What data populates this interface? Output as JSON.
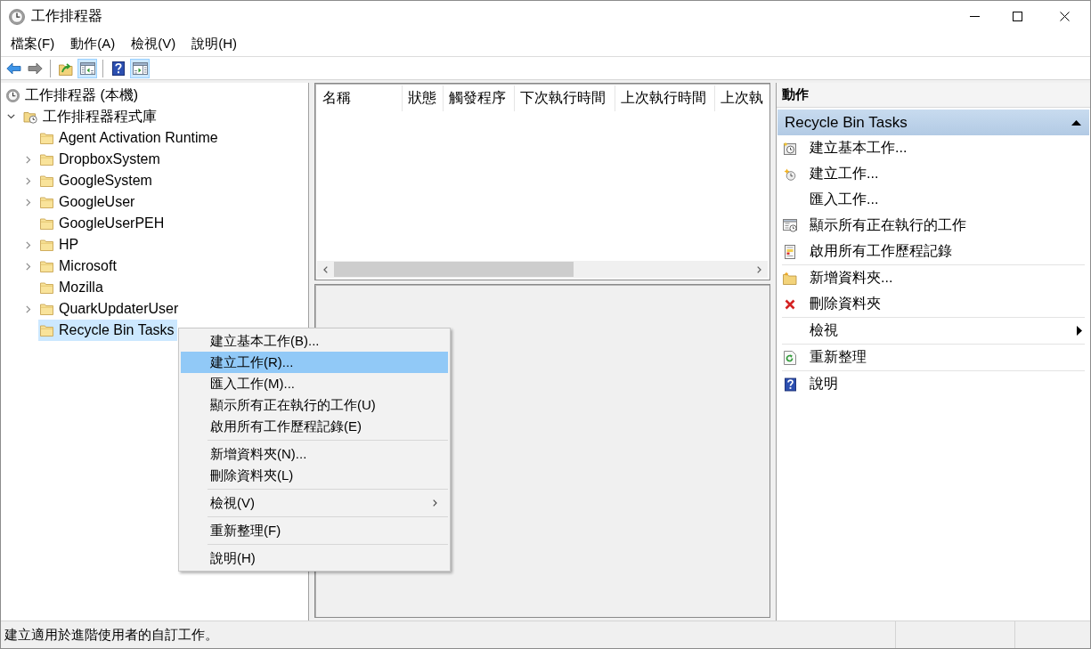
{
  "window": {
    "title": "工作排程器"
  },
  "menu_bar": {
    "items": [
      "檔案(F)",
      "動作(A)",
      "檢視(V)",
      "說明(H)"
    ]
  },
  "toolbar": {
    "items": [
      {
        "kind": "back",
        "disabled": false,
        "on": false
      },
      {
        "kind": "forward",
        "disabled": true,
        "on": false
      },
      {
        "kind": "separator"
      },
      {
        "kind": "up-folder",
        "disabled": false,
        "on": false
      },
      {
        "kind": "console-tree",
        "disabled": false,
        "on": true
      },
      {
        "kind": "separator"
      },
      {
        "kind": "help",
        "disabled": false,
        "on": false
      },
      {
        "kind": "action-pane",
        "disabled": false,
        "on": true
      }
    ]
  },
  "console_tree": {
    "items": [
      {
        "kind": "scheduler",
        "label": "工作排程器 (本機)",
        "selected": false,
        "children": [
          {
            "kind": "library",
            "label": "工作排程器程式庫",
            "expanded": true,
            "selected": false,
            "children": [
              {
                "kind": "folder",
                "label": "Agent Activation Runtime",
                "selected": false
              },
              {
                "kind": "folder",
                "label": "DropboxSystem",
                "expanded": false,
                "selected": false
              },
              {
                "kind": "folder",
                "label": "GoogleSystem",
                "expanded": false,
                "selected": false
              },
              {
                "kind": "folder",
                "label": "GoogleUser",
                "expanded": false,
                "selected": false
              },
              {
                "kind": "folder",
                "label": "GoogleUserPEH",
                "selected": false
              },
              {
                "kind": "folder",
                "label": "HP",
                "expanded": false,
                "selected": false
              },
              {
                "kind": "folder",
                "label": "Microsoft",
                "expanded": false,
                "selected": false
              },
              {
                "kind": "folder",
                "label": "Mozilla",
                "selected": false
              },
              {
                "kind": "folder",
                "label": "QuarkUpdaterUser",
                "expanded": false,
                "selected": false
              },
              {
                "kind": "folder",
                "label": "Recycle Bin Tasks",
                "selected": true
              }
            ]
          }
        ]
      }
    ]
  },
  "task_list": {
    "columns": [
      "名稱",
      "狀態",
      "觸發程序",
      "下次執行時間",
      "上次執行時間",
      "上次執"
    ]
  },
  "actions_pane": {
    "title": "動作",
    "sections": [
      {
        "title": "Recycle Bin Tasks",
        "expanded": true,
        "groups": [
          {
            "items": [
              {
                "kind": "basic-task",
                "label": "建立基本工作...",
                "submenu": false
              },
              {
                "kind": "task",
                "label": "建立工作...",
                "submenu": false
              },
              {
                "kind": "import",
                "label": "匯入工作...",
                "submenu": false
              },
              {
                "kind": "running",
                "label": "顯示所有正在執行的工作",
                "submenu": false
              },
              {
                "kind": "history",
                "label": "啟用所有工作歷程記錄",
                "submenu": false
              }
            ]
          },
          {
            "items": [
              {
                "kind": "new-folder",
                "label": "新增資料夾...",
                "submenu": false
              },
              {
                "kind": "delete",
                "label": "刪除資料夾",
                "submenu": false
              }
            ]
          },
          {
            "items": [
              {
                "kind": "view",
                "label": "檢視",
                "submenu": true
              }
            ]
          },
          {
            "items": [
              {
                "kind": "refresh",
                "label": "重新整理",
                "submenu": false
              }
            ]
          },
          {
            "items": [
              {
                "kind": "help",
                "label": "說明",
                "submenu": false
              }
            ]
          }
        ]
      }
    ]
  },
  "context_menu": {
    "groups": [
      {
        "items": [
          {
            "label": "建立基本工作(B)...",
            "selected": false,
            "submenu": false
          },
          {
            "label": "建立工作(R)...",
            "selected": true,
            "submenu": false
          },
          {
            "label": "匯入工作(M)...",
            "selected": false,
            "submenu": false
          },
          {
            "label": "顯示所有正在執行的工作(U)",
            "selected": false,
            "submenu": false
          },
          {
            "label": "啟用所有工作歷程記錄(E)",
            "selected": false,
            "submenu": false
          }
        ]
      },
      {
        "items": [
          {
            "label": "新增資料夾(N)...",
            "selected": false,
            "submenu": false
          },
          {
            "label": "刪除資料夾(L)",
            "selected": false,
            "submenu": false
          }
        ]
      },
      {
        "items": [
          {
            "label": "檢視(V)",
            "selected": false,
            "submenu": true
          }
        ]
      },
      {
        "items": [
          {
            "label": "重新整理(F)",
            "selected": false,
            "submenu": false
          }
        ]
      },
      {
        "items": [
          {
            "label": "說明(H)",
            "selected": false,
            "submenu": false
          }
        ]
      }
    ]
  },
  "status_bar": {
    "text": "建立適用於進階使用者的自訂工作。"
  }
}
